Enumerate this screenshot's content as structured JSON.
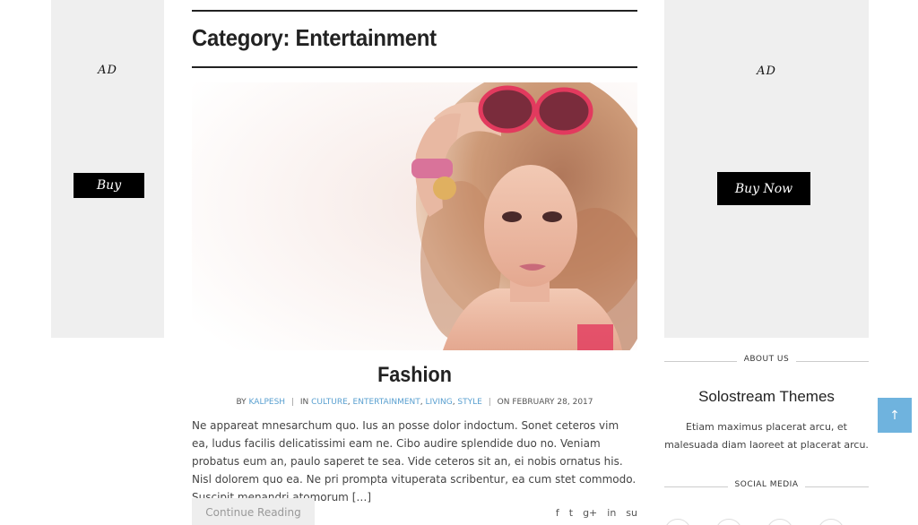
{
  "ads": {
    "left": {
      "label": "AD",
      "button": "Buy"
    },
    "right": {
      "label": "AD",
      "button": "Buy Now"
    }
  },
  "archive": {
    "title": "Category: Entertainment"
  },
  "post": {
    "title": "Fashion",
    "meta": {
      "by": "BY",
      "author": "KALPESH",
      "in": "IN",
      "categories": [
        "CULTURE",
        "ENTERTAINMENT",
        "LIVING",
        "STYLE"
      ],
      "date_prefix": "ON",
      "date": "FEBRUARY 28, 2017"
    },
    "excerpt": "Ne appareat mnesarchum quo. Ius an posse dolor indoctum. Sonet ceteros vim ea, ludus facilis delicatissimi eam ne. Cibo audire splendide duo no. Veniam probatus eum an, paulo saperet te sea. Vide ceteros sit an, ei nobis ornatus his. Nisl dolorem quo ea. Ne pri prompta vituperata scribentur, ea cum stet commodo. Suscipit menandri atomorum […]",
    "continue_label": "Continue Reading",
    "share_icons": [
      "f",
      "t",
      "g+",
      "in",
      "su"
    ]
  },
  "sidebar": {
    "about": {
      "heading": "ABOUT US",
      "title": "Solostream Themes",
      "text": "Etiam maximus placerat arcu, et malesuada diam laoreet at placerat arcu."
    },
    "social": {
      "heading": "SOCIAL MEDIA"
    }
  },
  "scroll_top": {
    "icon": "↑"
  }
}
